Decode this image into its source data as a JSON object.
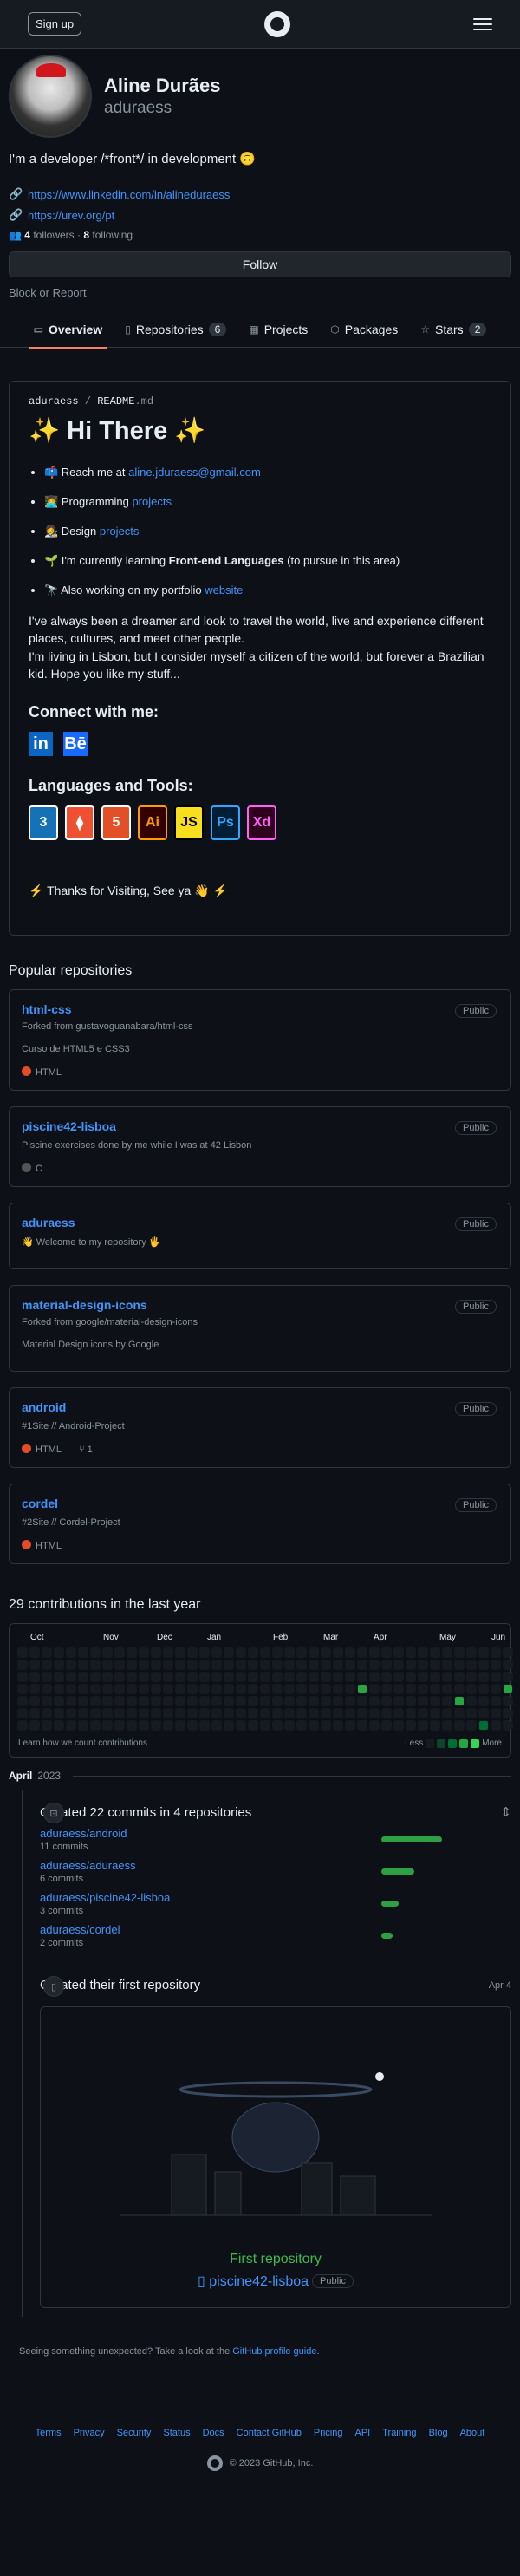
{
  "header": {
    "signup": "Sign up",
    "logo": "github-logo",
    "menu": "hamburger-icon"
  },
  "profile": {
    "fullname": "Aline Durães",
    "login": "aduraess",
    "bio": "I'm a developer /*front*/ in development 🙃",
    "links": [
      "https://www.linkedin.com/in/alineduraess",
      "https://urev.org/pt"
    ],
    "followers_count": "4",
    "followers_label": "followers",
    "separator": "·",
    "following_count": "8",
    "following_label": "following",
    "follow_btn": "Follow",
    "block": "Block or Report"
  },
  "tabs": [
    {
      "label": "Overview",
      "icon": "book-icon"
    },
    {
      "label": "Repositories",
      "icon": "repo-icon",
      "count": "6"
    },
    {
      "label": "Projects",
      "icon": "table-icon"
    },
    {
      "label": "Packages",
      "icon": "package-icon"
    },
    {
      "label": "Stars",
      "icon": "star-icon",
      "count": "2"
    }
  ],
  "readme": {
    "path_user": "aduraess",
    "path_sep": " / ",
    "path_file": "README",
    "path_ext": ".md",
    "title": "✨ Hi There ✨",
    "items": [
      {
        "pre": "📫 Reach me at ",
        "link": "aline.jduraess@gmail.com",
        "post": ""
      },
      {
        "pre": "👩‍💻 Programming ",
        "link": "projects",
        "post": ""
      },
      {
        "pre": "👩‍🎨 Design ",
        "link": "projects",
        "post": ""
      },
      {
        "pre": "🌱 I'm currently learning ",
        "bold": "Front-end Languages",
        "post": " (to pursue in this area)"
      },
      {
        "pre": "🔭 Also working on my portfolio ",
        "link": "website",
        "post": ""
      }
    ],
    "para1": "I've always been a dreamer and look to travel the world, live and experience different places, cultures, and meet other people.",
    "para2": "I'm living in Lisbon, but I consider myself a citizen of the world, but forever a Brazilian kid. Hope you like my stuff...",
    "connect": "Connect with me:",
    "social": [
      {
        "text": "in",
        "color": "#0a66c2"
      },
      {
        "text": "Bē",
        "color": "#1769ff"
      }
    ],
    "tools": "Languages and Tools:",
    "langs": [
      {
        "text": "3",
        "bg": "#1572b6",
        "fg": "#ffffff"
      },
      {
        "text": "⧫",
        "bg": "#f05032",
        "fg": "#ffffff"
      },
      {
        "text": "5",
        "bg": "#e34f26",
        "fg": "#ffffff"
      },
      {
        "text": "Ai",
        "bg": "#330000",
        "fg": "#ff9a00"
      },
      {
        "text": "JS",
        "bg": "#f7df1e",
        "fg": "#000000"
      },
      {
        "text": "Ps",
        "bg": "#001e36",
        "fg": "#31a8ff"
      },
      {
        "text": "Xd",
        "bg": "#2e001e",
        "fg": "#ff61f6"
      }
    ],
    "thanks": "⚡ Thanks for Visiting, See ya 👋 ⚡"
  },
  "popular": {
    "title": "Popular repositories",
    "repos": [
      {
        "name": "html-css",
        "visibility": "Public",
        "fork": "Forked from gustavoguanabara/html-css",
        "desc": "Curso de HTML5 e CSS3",
        "lang": "HTML",
        "color": "#e34c26",
        "forks": ""
      },
      {
        "name": "piscine42-lisboa",
        "visibility": "Public",
        "fork": "",
        "desc": "Piscine exercises done by me while I was at 42 Lisbon",
        "lang": "C",
        "color": "#555555",
        "forks": ""
      },
      {
        "name": "aduraess",
        "visibility": "Public",
        "fork": "",
        "desc": "👋 Welcome to my repository 🖐",
        "lang": "",
        "color": "",
        "forks": ""
      },
      {
        "name": "material-design-icons",
        "visibility": "Public",
        "fork": "Forked from google/material-design-icons",
        "desc": "Material Design icons by Google",
        "lang": "",
        "color": "",
        "forks": ""
      },
      {
        "name": "android",
        "visibility": "Public",
        "fork": "",
        "desc": "#1Site // Android-Project",
        "lang": "HTML",
        "color": "#e34c26",
        "forks": "1"
      },
      {
        "name": "cordel",
        "visibility": "Public",
        "fork": "",
        "desc": "#2Site // Cordel-Project",
        "lang": "HTML",
        "color": "#e34c26",
        "forks": ""
      }
    ]
  },
  "contributions": {
    "title": "29 contributions in the last year",
    "months": [
      "Oct",
      "Nov",
      "Dec",
      "Jan",
      "Feb",
      "Mar",
      "Apr",
      "May",
      "Jun"
    ],
    "learn": "Learn how we count contributions",
    "less": "Less",
    "more": "More",
    "colors": [
      "#161b22",
      "#0e4429",
      "#006d32",
      "#26a641",
      "#39d353"
    ]
  },
  "activity": {
    "month": "April",
    "year": "2023",
    "commits_title": "Created 22 commits in 4 repositories",
    "commits": [
      {
        "repo": "aduraess/android",
        "count": "11 commits",
        "share": 0.5
      },
      {
        "repo": "aduraess/aduraess",
        "count": "6 commits",
        "share": 0.27
      },
      {
        "repo": "aduraess/piscine42-lisboa",
        "count": "3 commits",
        "share": 0.14
      },
      {
        "repo": "aduraess/cordel",
        "count": "2 commits",
        "share": 0.09
      }
    ],
    "first_title": "Created their first repository",
    "first_date": "Apr 4",
    "first_label": "First repository",
    "first_repo": "piscine42-lisboa",
    "first_visibility": "Public"
  },
  "unexpected": {
    "pre": "Seeing something unexpected? Take a look at the ",
    "link": "GitHub profile guide",
    "post": "."
  },
  "footer": {
    "links": [
      "Terms",
      "Privacy",
      "Security",
      "Status",
      "Docs",
      "Contact GitHub",
      "Pricing",
      "API",
      "Training",
      "Blog",
      "About"
    ],
    "copyright": "© 2023 GitHub, Inc."
  }
}
